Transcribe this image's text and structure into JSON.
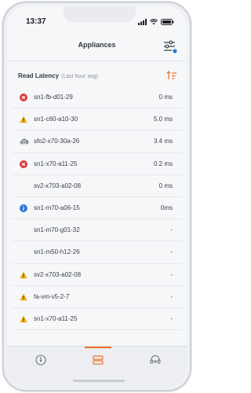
{
  "status": {
    "time": "13:37"
  },
  "header": {
    "title": "Appliances"
  },
  "section": {
    "title": "Read Latency",
    "subtitle": "(Last hour avg)"
  },
  "colors": {
    "accent": "#f0702a",
    "error": "#e0363c",
    "warning": "#f2b015",
    "info": "#2f7ad6",
    "cloud": "#8f949c"
  },
  "rows": [
    {
      "name": "sn1-fb-d01-29",
      "value": "0 ms",
      "status": "error",
      "icon": "error-icon"
    },
    {
      "name": "sn1-c60-a10-30",
      "value": "5.0 ms",
      "status": "warning",
      "icon": "warning-icon"
    },
    {
      "name": "sfo2-x70-30a-26",
      "value": "3.4 ms",
      "status": "cloud",
      "icon": "cloud-sync-icon"
    },
    {
      "name": "sn1-x70-a11-25",
      "value": "0.2 ms",
      "status": "error",
      "icon": "error-icon"
    },
    {
      "name": "sv2-x703-a02-08",
      "value": "0 ms",
      "status": "none",
      "icon": ""
    },
    {
      "name": "sn1-m70-a06-15",
      "value": "0ms",
      "status": "info",
      "icon": "info-icon"
    },
    {
      "name": "sn1-m70-g01-32",
      "value": "-",
      "status": "none",
      "icon": ""
    },
    {
      "name": "sn1-m50-h12-26",
      "value": "-",
      "status": "none",
      "icon": ""
    },
    {
      "name": "sv2-x703-a02-08",
      "value": "-",
      "status": "warning",
      "icon": "warning-icon"
    },
    {
      "name": "fa-vm-v5-2-7",
      "value": "-",
      "status": "warning",
      "icon": "warning-icon"
    },
    {
      "name": "sn1-x70-a11-25",
      "value": "-",
      "status": "warning",
      "icon": "warning-icon"
    }
  ],
  "tabs": [
    {
      "icon": "dashboard-gauge-icon",
      "active": false
    },
    {
      "icon": "appliances-icon",
      "active": true
    },
    {
      "icon": "support-headset-icon",
      "active": false
    }
  ]
}
